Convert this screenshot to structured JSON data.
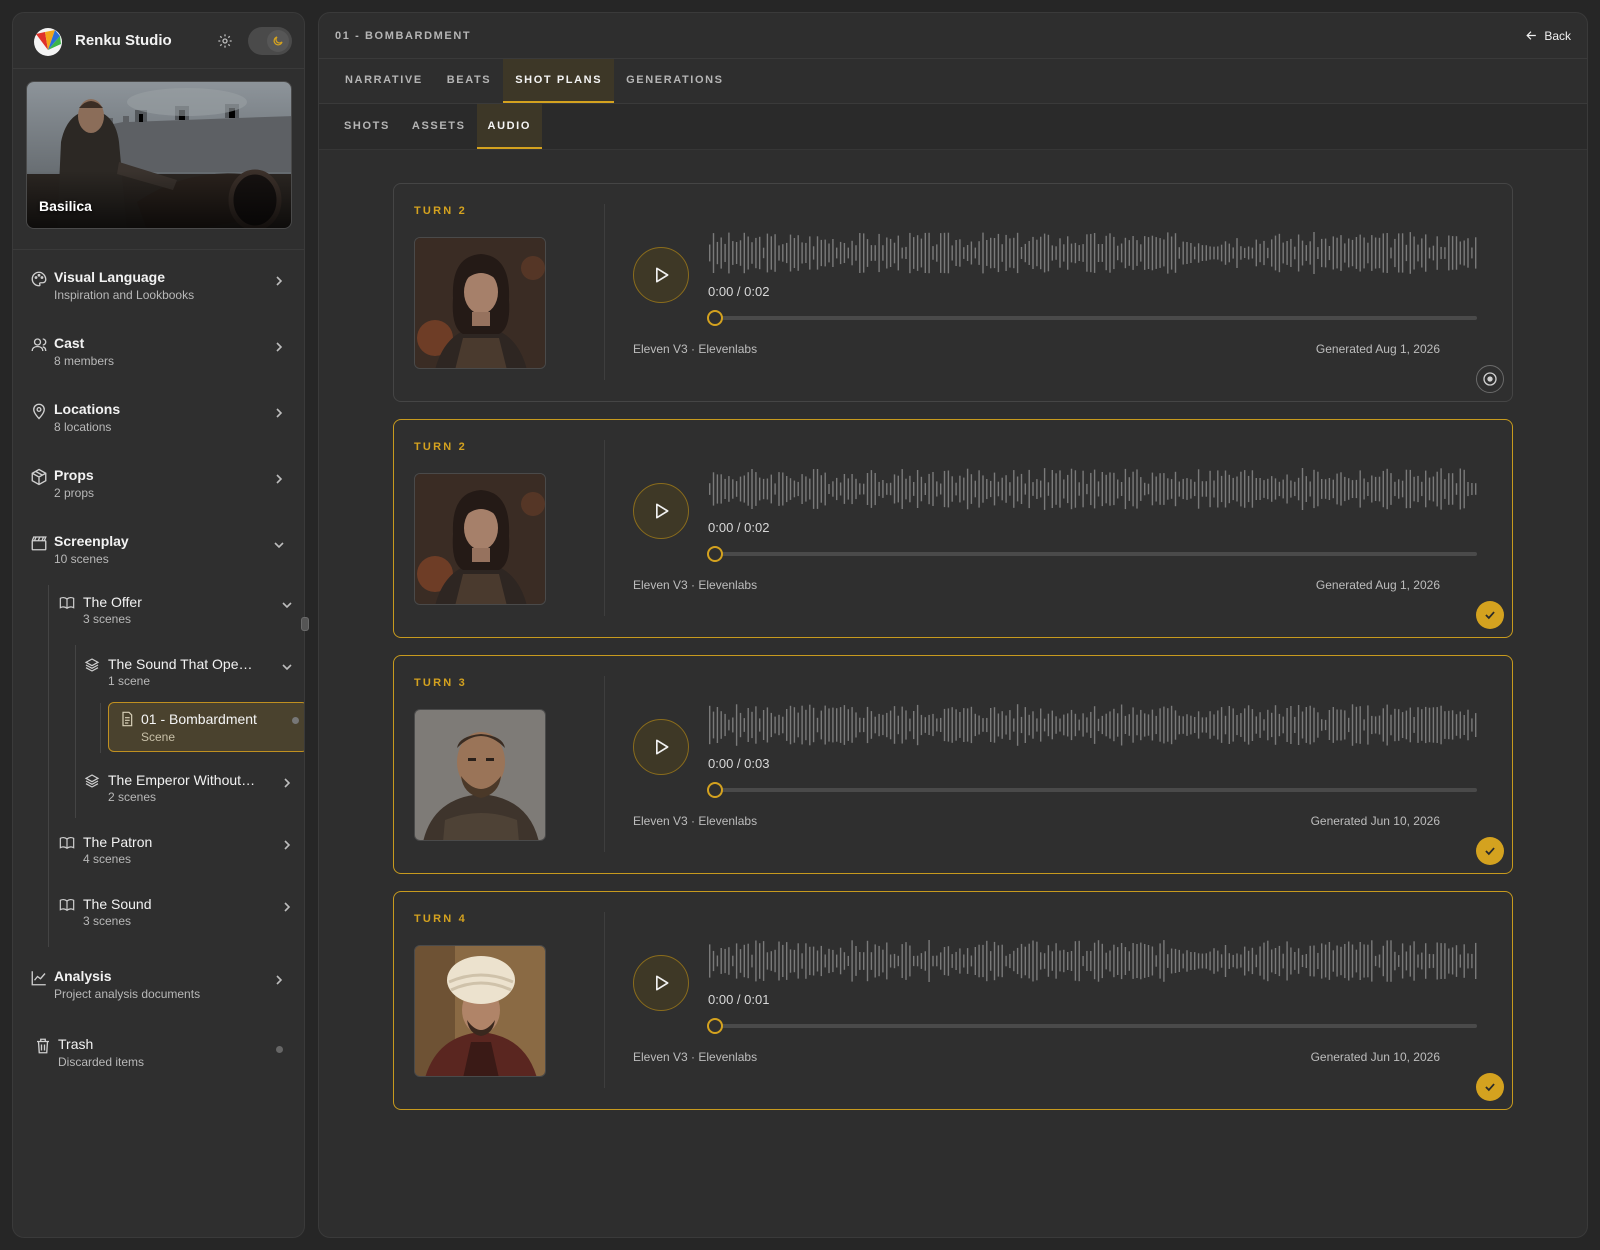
{
  "app": {
    "title": "Renku Studio"
  },
  "project": {
    "name": "Basilica"
  },
  "sidebar": {
    "items": [
      {
        "label": "Visual Language",
        "sub": "Inspiration and Lookbooks"
      },
      {
        "label": "Cast",
        "sub": "8 members"
      },
      {
        "label": "Locations",
        "sub": "8 locations"
      },
      {
        "label": "Props",
        "sub": "2 props"
      },
      {
        "label": "Screenplay",
        "sub": "10 scenes"
      },
      {
        "label": "Analysis",
        "sub": "Project analysis documents"
      },
      {
        "label": "Trash",
        "sub": "Discarded items"
      }
    ],
    "tree": {
      "the_offer": {
        "label": "The Offer",
        "sub": "3 scenes"
      },
      "sound_opens": {
        "label": "The Sound That Opens the Wall",
        "sub": "1 scene"
      },
      "bombardment": {
        "label": "01 - Bombardment",
        "sub": "Scene"
      },
      "emperor": {
        "label": "The Emperor Without a Throne",
        "sub": "2 scenes"
      },
      "the_patron": {
        "label": "The Patron",
        "sub": "4 scenes"
      },
      "the_sound": {
        "label": "The Sound",
        "sub": "3 scenes"
      }
    }
  },
  "header": {
    "breadcrumb": "01 - BOMBARDMENT",
    "back_label": "Back"
  },
  "tabs": [
    "NARRATIVE",
    "BEATS",
    "SHOT PLANS",
    "GENERATIONS"
  ],
  "active_tab": "SHOT PLANS",
  "subtabs": [
    "SHOTS",
    "ASSETS",
    "AUDIO"
  ],
  "active_subtab": "AUDIO",
  "colors": {
    "accent": "#d4a21f",
    "background": "#262626",
    "panel": "#2e2e2e"
  },
  "audio_cards": [
    {
      "turn": "TURN 2",
      "time": "0:00 / 0:02",
      "progress": 0,
      "model": "Eleven V3 · Elevenlabs",
      "generated": "Generated Aug 1, 2026",
      "selected": false,
      "portrait": "woman"
    },
    {
      "turn": "TURN 2",
      "time": "0:00 / 0:02",
      "progress": 0,
      "model": "Eleven V3 · Elevenlabs",
      "generated": "Generated Aug 1, 2026",
      "selected": true,
      "portrait": "woman"
    },
    {
      "turn": "TURN 3",
      "time": "0:00 / 0:03",
      "progress": 0,
      "model": "Eleven V3 · Elevenlabs",
      "generated": "Generated Jun 10, 2026",
      "selected": true,
      "portrait": "man"
    },
    {
      "turn": "TURN 4",
      "time": "0:00 / 0:01",
      "progress": 0,
      "model": "Eleven V3 · Elevenlabs",
      "generated": "Generated Jun 10, 2026",
      "selected": true,
      "portrait": "turban"
    }
  ],
  "icons": {
    "settings": "gear-icon",
    "theme": "moon-icon",
    "back": "arrow-left-icon",
    "play": "play-icon",
    "select_on": "check-icon",
    "select_off": "radio-icon"
  }
}
